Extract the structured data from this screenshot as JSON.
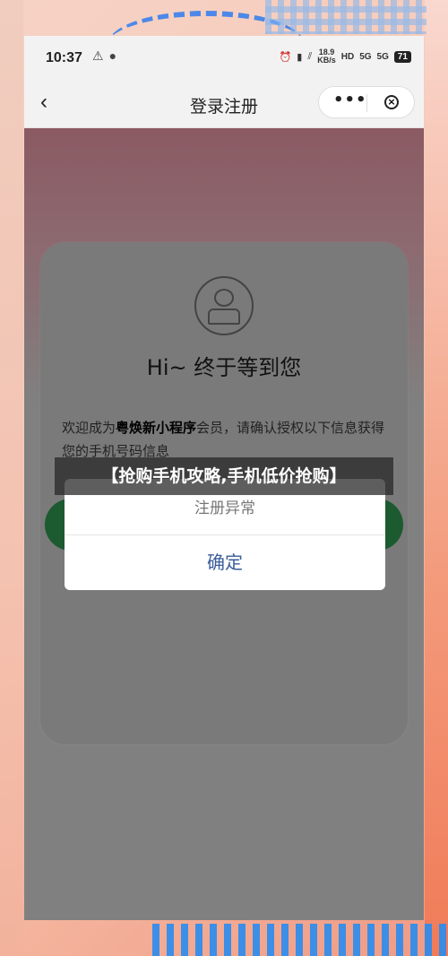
{
  "status_bar": {
    "time": "10:37",
    "net_speed_value": "18.9",
    "net_speed_unit": "KB/s",
    "hd_label": "HD",
    "signal_1": "5G",
    "signal_2": "5G",
    "battery": "71"
  },
  "nav": {
    "back_icon": "‹",
    "title": "登录注册",
    "more_label": "•••"
  },
  "card": {
    "greeting": "Hi~ 终于等到您",
    "welcome_prefix": "欢迎成为",
    "brand": "粤焕新小程序",
    "welcome_suffix": "会员，请确认授权以下信息获得您的手机号码信息"
  },
  "dialog": {
    "message": "注册异常",
    "confirm_label": "确定"
  },
  "banner": {
    "text": "【抢购手机攻略,手机低价抢购】"
  }
}
